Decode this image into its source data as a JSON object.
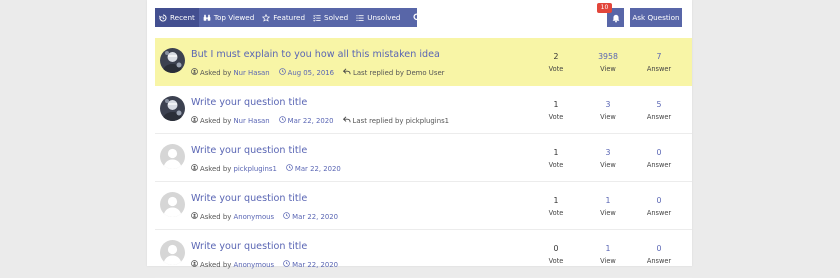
{
  "toolbar": {
    "tabs": [
      {
        "label": "Recent",
        "icon": "history-icon"
      },
      {
        "label": "Top Viewed",
        "icon": "binoculars-icon"
      },
      {
        "label": "Featured",
        "icon": "star-icon"
      },
      {
        "label": "Solved",
        "icon": "list-check-icon"
      },
      {
        "label": "Unsolved",
        "icon": "list-icon"
      }
    ],
    "search_icon": "search-icon",
    "notification_count": "10",
    "ask_label": "Ask Question"
  },
  "labels": {
    "asked_by": "Asked by",
    "last_replied_by": "Last replied by",
    "vote": "Vote",
    "view": "View",
    "answer": "Answer"
  },
  "questions": [
    {
      "title": "But I must explain to you how all this mistaken idea",
      "author": "Nur Hasan",
      "date": "Aug 05, 2016",
      "last_replied": "Demo User",
      "votes": "2",
      "views": "3958",
      "answers": "7",
      "avatar": "photo",
      "highlighted": true
    },
    {
      "title": "Write your question title",
      "author": "Nur Hasan",
      "date": "Mar 22, 2020",
      "last_replied": "pickplugins1",
      "votes": "1",
      "views": "3",
      "answers": "5",
      "avatar": "photo",
      "highlighted": false
    },
    {
      "title": "Write your question title",
      "author": "pickplugins1",
      "date": "Mar 22, 2020",
      "last_replied": "",
      "votes": "1",
      "views": "3",
      "answers": "0",
      "avatar": "default",
      "highlighted": false
    },
    {
      "title": "Write your question title",
      "author": "Anonymous",
      "date": "Mar 22, 2020",
      "last_replied": "",
      "votes": "1",
      "views": "1",
      "answers": "0",
      "avatar": "default",
      "highlighted": false
    },
    {
      "title": "Write your question title",
      "author": "Anonymous",
      "date": "Mar 22, 2020",
      "last_replied": "",
      "votes": "0",
      "views": "1",
      "answers": "0",
      "avatar": "default",
      "highlighted": false
    }
  ],
  "colors": {
    "accent": "#5866a8",
    "link": "#5a66b4",
    "highlight": "#f8f5a6",
    "badge": "#e2463b"
  }
}
